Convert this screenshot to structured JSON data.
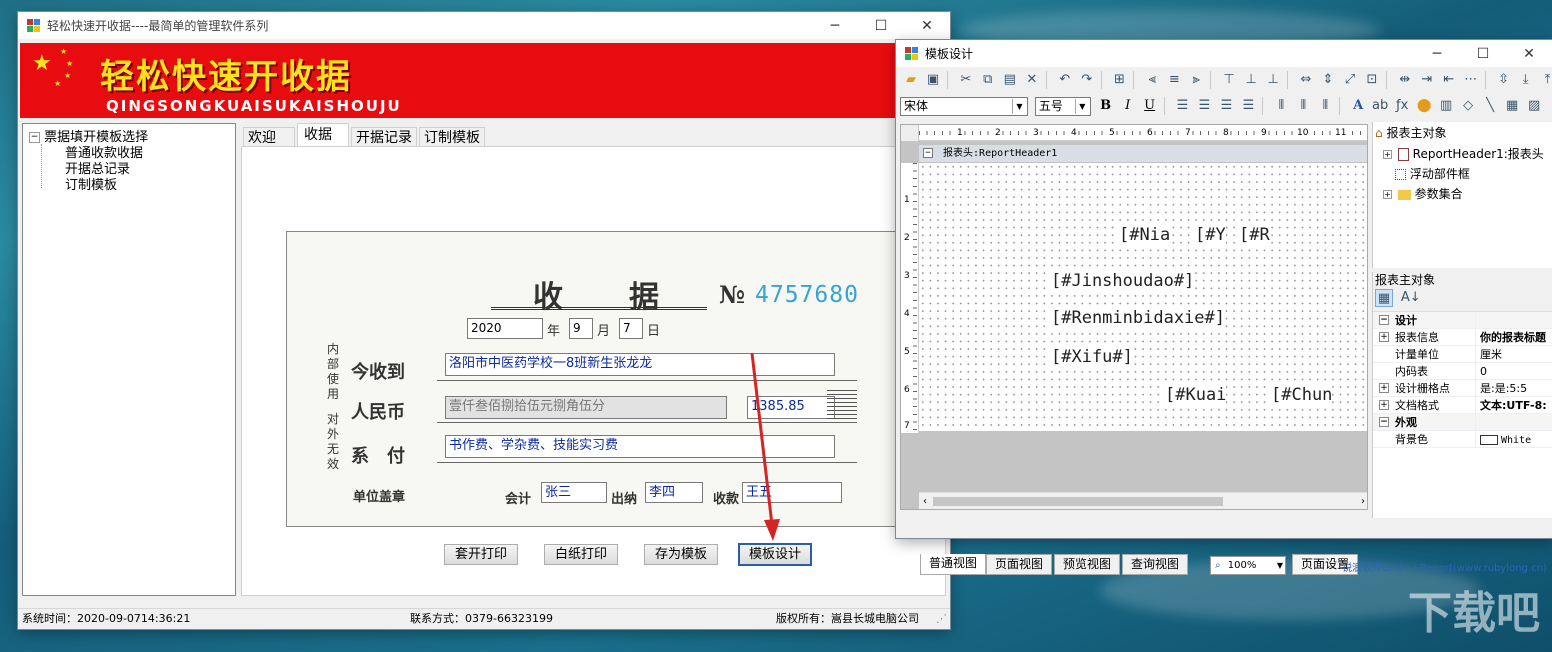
{
  "main_window": {
    "title": "轻松快速开收据----最简单的管理软件系列",
    "banner": {
      "title": "轻松快速开收据",
      "subtitle": "QINGSONGKUAISUKAISHOUJU"
    },
    "tree": {
      "root": "票据填开模板选择",
      "items": [
        "普通收款收据",
        "开据总记录",
        "订制模板"
      ]
    },
    "tabs": [
      "欢迎",
      "收据",
      "开据记录",
      "订制模板"
    ],
    "receipt": {
      "title": "收　　据",
      "number_prefix": "№",
      "number": "4757680",
      "year": "2020",
      "year_label": "年",
      "month": "9",
      "month_label": "月",
      "day": "7",
      "day_label": "日",
      "side_text_top": "内部使用",
      "side_text_bottom": "对外无效",
      "received_label": "今收到",
      "received_value": "洛阳市中医药学校一8班新生张龙龙",
      "rmb_label": "人民币",
      "rmb_text": "壹仟叁佰捌拾伍元捌角伍分",
      "rmb_amount": "1385.85",
      "pay_label": "系　付",
      "pay_value": "书作费、学杂费、技能实习费",
      "seal_label": "单位盖章",
      "accountant_label": "会计",
      "accountant": "张三",
      "cashier_label": "出纳",
      "cashier": "李四",
      "payee_label": "收款",
      "payee": "王五"
    },
    "buttons": {
      "print_template": "套开打印",
      "print_blank": "白纸打印",
      "save_template": "存为模板",
      "design_template": "模板设计"
    },
    "status": {
      "time": "系统时间：2020-09-0714:36:21",
      "contact": "联系方式：0379-66323199",
      "copyright": "版权所有：嵩县长城电脑公司"
    }
  },
  "designer_window": {
    "title": "模板设计",
    "font_name": "宋体",
    "font_size": "五号",
    "ruler_numbers": [
      "1",
      "2",
      "3",
      "4",
      "5",
      "6",
      "7",
      "8",
      "9",
      "10",
      "11"
    ],
    "vruler_numbers": [
      "1",
      "2",
      "3",
      "4",
      "5",
      "6",
      "7"
    ],
    "section_header": "报表头:ReportHeader1",
    "fields": {
      "nian": "[#Nia",
      "yue": "[#Y",
      "ri": "[#R",
      "jinshoudao": "[#Jinshoudao#]",
      "renmin": "[#Renminbidaxie#]",
      "xifu": "[#Xifu#]",
      "kuaiji": "[#Kuai",
      "chuna": "[#Chun"
    },
    "object_tree": {
      "root": "报表主对象",
      "items": [
        "ReportHeader1:报表头",
        "浮动部件框",
        "参数集合"
      ]
    },
    "props_title": "报表主对象",
    "props": {
      "design_group": "设计",
      "report_info": {
        "key": "报表信息",
        "value": "你的报表标题"
      },
      "unit": {
        "key": "计量单位",
        "value": "厘米"
      },
      "inner_code": {
        "key": "内码表",
        "value": "0"
      },
      "grid": {
        "key": "设计栅格点",
        "value": "是:是:5:5"
      },
      "doc_format": {
        "key": "文档格式",
        "value": "文本:UTF-8:"
      },
      "look_group": "外观",
      "bgcolor": {
        "key": "背景色",
        "value": "White"
      }
    },
    "view_tabs": [
      "普通视图",
      "页面视图",
      "预览视图",
      "查询视图"
    ],
    "zoom": "100%",
    "page_setup": "页面设置",
    "footer_credit": "锐浪软件Grid++Report(www.rubylong.cn)"
  },
  "watermark": "下载吧",
  "colors": {
    "banner_red": "#e80c10",
    "banner_yellow": "#ffe21a",
    "link_blue": "#0b2b9e",
    "arrow_red": "#d42424"
  }
}
